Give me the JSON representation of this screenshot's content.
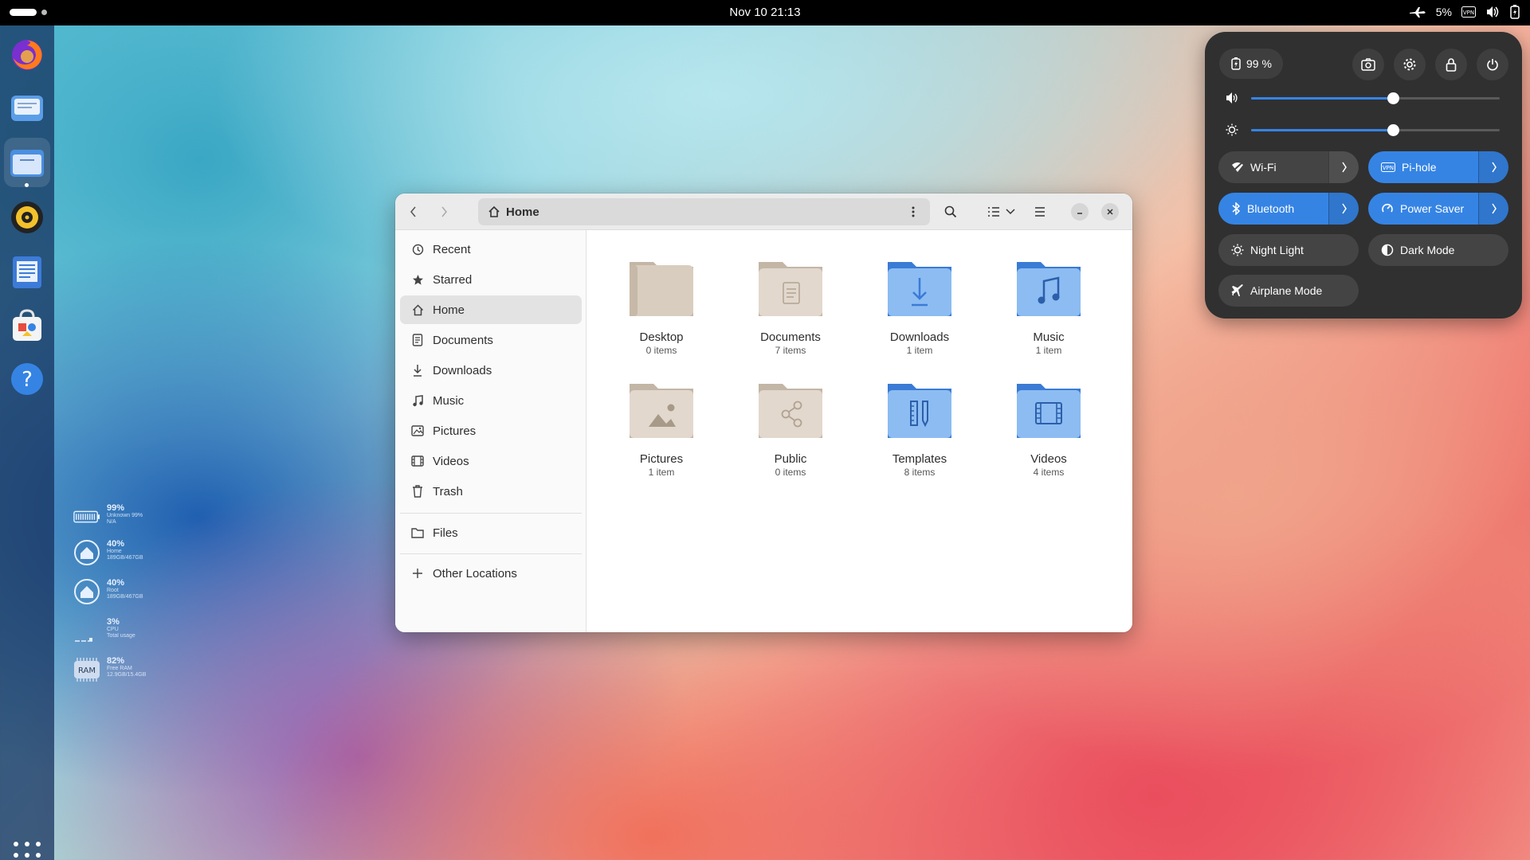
{
  "topbar": {
    "clock": "Nov 10  21:13",
    "battery_percent": "5%"
  },
  "dock": {
    "apps": [
      "firefox-icon",
      "mail-icon",
      "files-icon",
      "rhythmbox-icon",
      "text-editor-icon",
      "software-icon",
      "help-icon"
    ]
  },
  "widgets": [
    {
      "pct": "99%",
      "l1": "Unknown 99%",
      "l2": "N/A",
      "icon": "battery-icon"
    },
    {
      "pct": "40%",
      "l1": "Home",
      "l2": "189GB/467GB",
      "icon": "home-disk-icon"
    },
    {
      "pct": "40%",
      "l1": "Root",
      "l2": "189GB/467GB",
      "icon": "root-disk-icon"
    },
    {
      "pct": "3%",
      "l1": "CPU",
      "l2": "Total usage",
      "icon": "cpu-icon"
    },
    {
      "pct": "82%",
      "l1": "Free RAM",
      "l2": "12.9GB/15.4GB",
      "icon": "ram-icon",
      "badge": "RAM"
    }
  ],
  "window": {
    "path": "Home",
    "sidebar": [
      {
        "label": "Recent",
        "icon": "clock-icon"
      },
      {
        "label": "Starred",
        "icon": "star-icon"
      },
      {
        "label": "Home",
        "icon": "home-icon",
        "selected": true
      },
      {
        "label": "Documents",
        "icon": "document-icon"
      },
      {
        "label": "Downloads",
        "icon": "download-icon"
      },
      {
        "label": "Music",
        "icon": "music-icon"
      },
      {
        "label": "Pictures",
        "icon": "picture-icon"
      },
      {
        "label": "Videos",
        "icon": "video-icon"
      },
      {
        "label": "Trash",
        "icon": "trash-icon"
      },
      {
        "label": "Files",
        "icon": "folder-icon"
      },
      {
        "label": "Other Locations",
        "icon": "plus-icon"
      }
    ],
    "folders": [
      {
        "name": "Desktop",
        "count": "0 items",
        "style": "beige",
        "icon": "desktop-folder-icon"
      },
      {
        "name": "Documents",
        "count": "7 items",
        "style": "beige",
        "icon": "documents-folder-icon"
      },
      {
        "name": "Downloads",
        "count": "1 item",
        "style": "blue",
        "icon": "downloads-folder-icon"
      },
      {
        "name": "Music",
        "count": "1 item",
        "style": "blue",
        "icon": "music-folder-icon"
      },
      {
        "name": "Pictures",
        "count": "1 item",
        "style": "beige",
        "icon": "pictures-folder-icon"
      },
      {
        "name": "Public",
        "count": "0 items",
        "style": "beige",
        "icon": "public-folder-icon"
      },
      {
        "name": "Templates",
        "count": "8 items",
        "style": "blue",
        "icon": "templates-folder-icon"
      },
      {
        "name": "Videos",
        "count": "4 items",
        "style": "blue",
        "icon": "videos-folder-icon"
      }
    ]
  },
  "quick_settings": {
    "battery": "99 %",
    "volume_level": 0.57,
    "brightness_level": 0.57,
    "toggles": [
      {
        "label": "Wi-Fi",
        "on": false,
        "has_arrow": true
      },
      {
        "label": "Pi-hole",
        "on": true,
        "has_arrow": true
      },
      {
        "label": "Bluetooth",
        "on": true,
        "has_arrow": true
      },
      {
        "label": "Power Saver",
        "on": true,
        "has_arrow": true
      },
      {
        "label": "Night Light",
        "on": false,
        "has_arrow": false
      },
      {
        "label": "Dark Mode",
        "on": false,
        "has_arrow": false
      },
      {
        "label": "Airplane Mode",
        "on": false,
        "has_arrow": false
      }
    ]
  },
  "colors": {
    "accent": "#3584e4",
    "folder_blue": "#4a8fe0",
    "folder_beige": "#d9cdbf"
  }
}
